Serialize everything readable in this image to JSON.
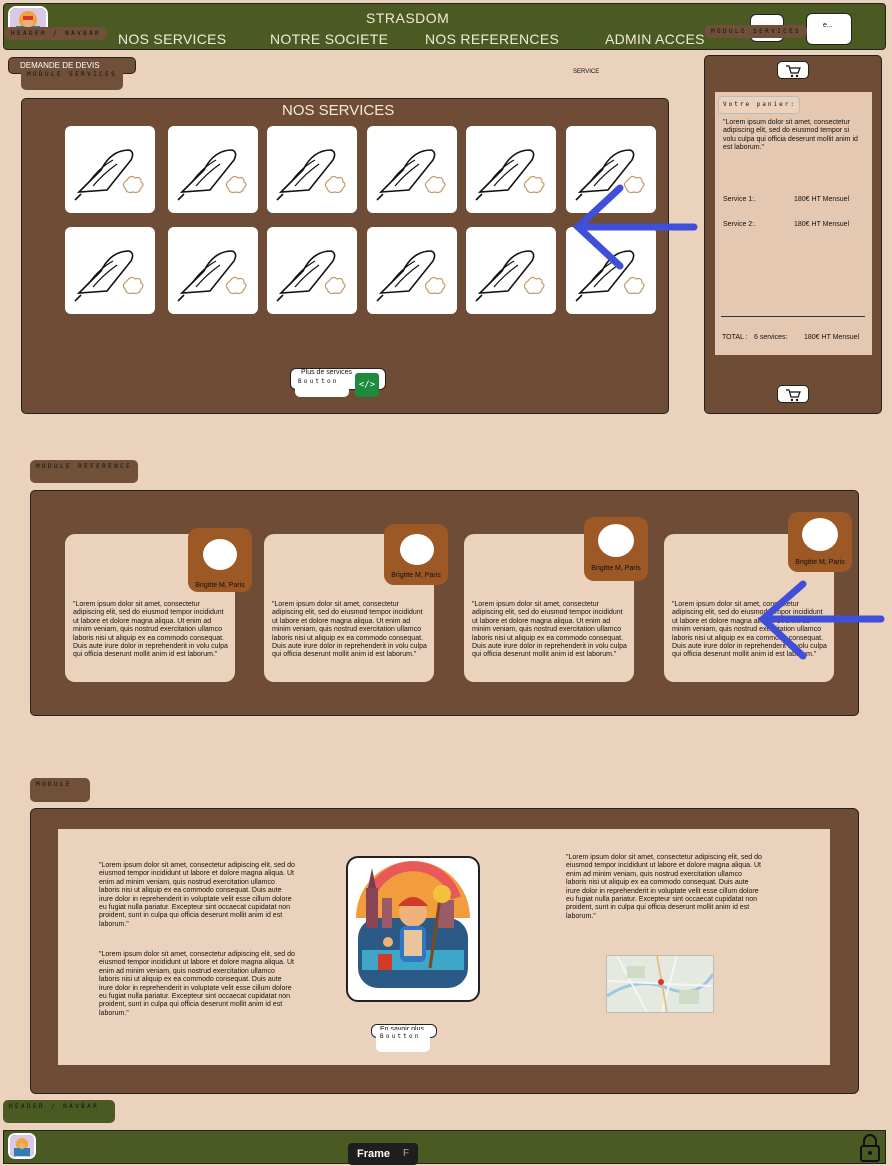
{
  "header": {
    "brand": "STRASDOM",
    "nav": [
      "NOS SERVICES",
      "NOTRE SOCIETE",
      "NOS REFERENCES",
      "ADMIN ACCES"
    ],
    "tag_label": "HEADER / NAVBAR",
    "right_button_label": "e..."
  },
  "tags": {
    "module_services_top": "MODULE SERVICES",
    "module_services_left": "MODULE SERVICES",
    "demande_de_devis": "DEMANDE DE DEVIS",
    "module_reference": "MODULE REFERENCE",
    "module": "MODULE",
    "footer_header": "HEADER / NAVBAR"
  },
  "services": {
    "small_label": "SERVICE",
    "title": "NOS SERVICES",
    "tiles": [
      "iron-icon",
      "iron-icon",
      "iron-icon",
      "iron-icon",
      "iron-icon",
      "iron-icon",
      "iron-icon",
      "iron-icon",
      "iron-icon",
      "iron-icon",
      "iron-icon",
      "iron-icon"
    ],
    "more_button_label": "Plus de services",
    "button_tag": "Boutton"
  },
  "cart": {
    "title": "Votre panier:",
    "intro": "\"Lorem ipsum dolor sit amet, consectetur adipiscing elit, sed do eiusmod tempor si volu culpa qui officia deserunt mollit anim id est laborum.\"",
    "items": [
      {
        "label": "Service 1:.",
        "price": "180€ HT Mensuel"
      },
      {
        "label": "Service 2:.",
        "price": "180€ HT Mensuel"
      }
    ],
    "total_label": "TOTAL :",
    "total_count": "6 services:",
    "total_price": "180€ HT Mensuel"
  },
  "references": {
    "cards": [
      {
        "name": "Brigitte M, Paris",
        "text": "\"Lorem ipsum dolor sit amet, consectetur adipiscing elit, sed do eiusmod tempor incididunt ut labore et dolore magna aliqua. Ut enim ad minim veniam, quis nostrud exercitation ullamco laboris nisi ut aliquip ex ea commodo consequat. Duis aute irure dolor in reprehenderit in volu culpa qui officia deserunt mollit anim id est laborum.\""
      },
      {
        "name": "Brigitte M, Paris",
        "text": "\"Lorem ipsum dolor sit amet, consectetur adipiscing elit, sed do eiusmod tempor incididunt ut labore et dolore magna aliqua. Ut enim ad minim veniam, quis nostrud exercitation ullamco laboris nisi ut aliquip ex ea commodo consequat. Duis aute irure dolor in reprehenderit in volu culpa qui officia deserunt mollit anim id est laborum.\""
      },
      {
        "name": "Brigitte M, Paris",
        "text": "\"Lorem ipsum dolor sit amet, consectetur adipiscing elit, sed do eiusmod tempor incididunt ut labore et dolore magna aliqua. Ut enim ad minim veniam, quis nostrud exercitation ullamco laboris nisi ut aliquip ex ea commodo consequat. Duis aute irure dolor in reprehenderit in volu culpa qui officia deserunt mollit anim id est laborum.\""
      },
      {
        "name": "Brigitte M, Paris",
        "text": "\"Lorem ipsum dolor sit amet, consectetur adipiscing elit, sed do eiusmod tempor incididunt ut labore et dolore magna aliqua. Ut enim ad minim veniam, quis nostrud exercitation ullamco laboris nisi ut aliquip ex ea commodo consequat. Duis aute irure dolor in reprehenderit in volu culpa qui officia deserunt mollit anim id est laborum.\""
      }
    ]
  },
  "module": {
    "left_para_1": "\"Lorem ipsum dolor sit amet, consectetur adipiscing elit, sed do eiusmod tempor incididunt ut labore et dolore magna aliqua. Ut enim ad minim veniam, quis nostrud exercitation ullamco laboris nisi ut aliquip ex ea commodo consequat. Duis aute irure dolor in reprehenderit in voluptate velit esse cillum dolore eu fugiat nulla pariatur. Excepteur sint occaecat cupidatat non proident, sunt in culpa qui officia deserunt mollit anim id est laborum.\"",
    "left_para_2": "\"Lorem ipsum dolor sit amet, consectetur adipiscing elit, sed do eiusmod tempor incididunt ut labore et dolore magna aliqua. Ut enim ad minim veniam, quis nostrud exercitation ullamco laboris nisi ut aliquip ex ea commodo consequat. Duis aute irure dolor in reprehenderit in voluptate velit esse cillum dolore eu fugiat nulla pariatur. Excepteur sint occaecat cupidatat non proident, sunt in culpa qui officia deserunt mollit anim id est laborum.\"",
    "right_para": "\"Lorem ipsum dolor sit amet, consectetur adipiscing elit, sed do eiusmod tempor incididunt ut labore et dolore magna aliqua. Ut enim ad minim veniam, quis nostrud exercitation ullamco laboris nisi ut aliquip ex ea commodo consequat. Duis aute irure dolor in reprehenderit in voluptate velit esse cillum dolore eu fugiat nulla pariatur. Excepteur sint occaecat cupidatat non proident, sunt in culpa qui officia deserunt mollit anim id est laborum.\"",
    "button_text": "En savoir plus",
    "button_tag": "Boutton"
  },
  "frame_indicator": {
    "label": "Frame",
    "key": "F"
  },
  "colors": {
    "olive": "#4b5a22",
    "brown": "#6f4c35",
    "beige": "#ead2bc",
    "arrow": "#3f4fd9",
    "badge": "#9c5825"
  }
}
